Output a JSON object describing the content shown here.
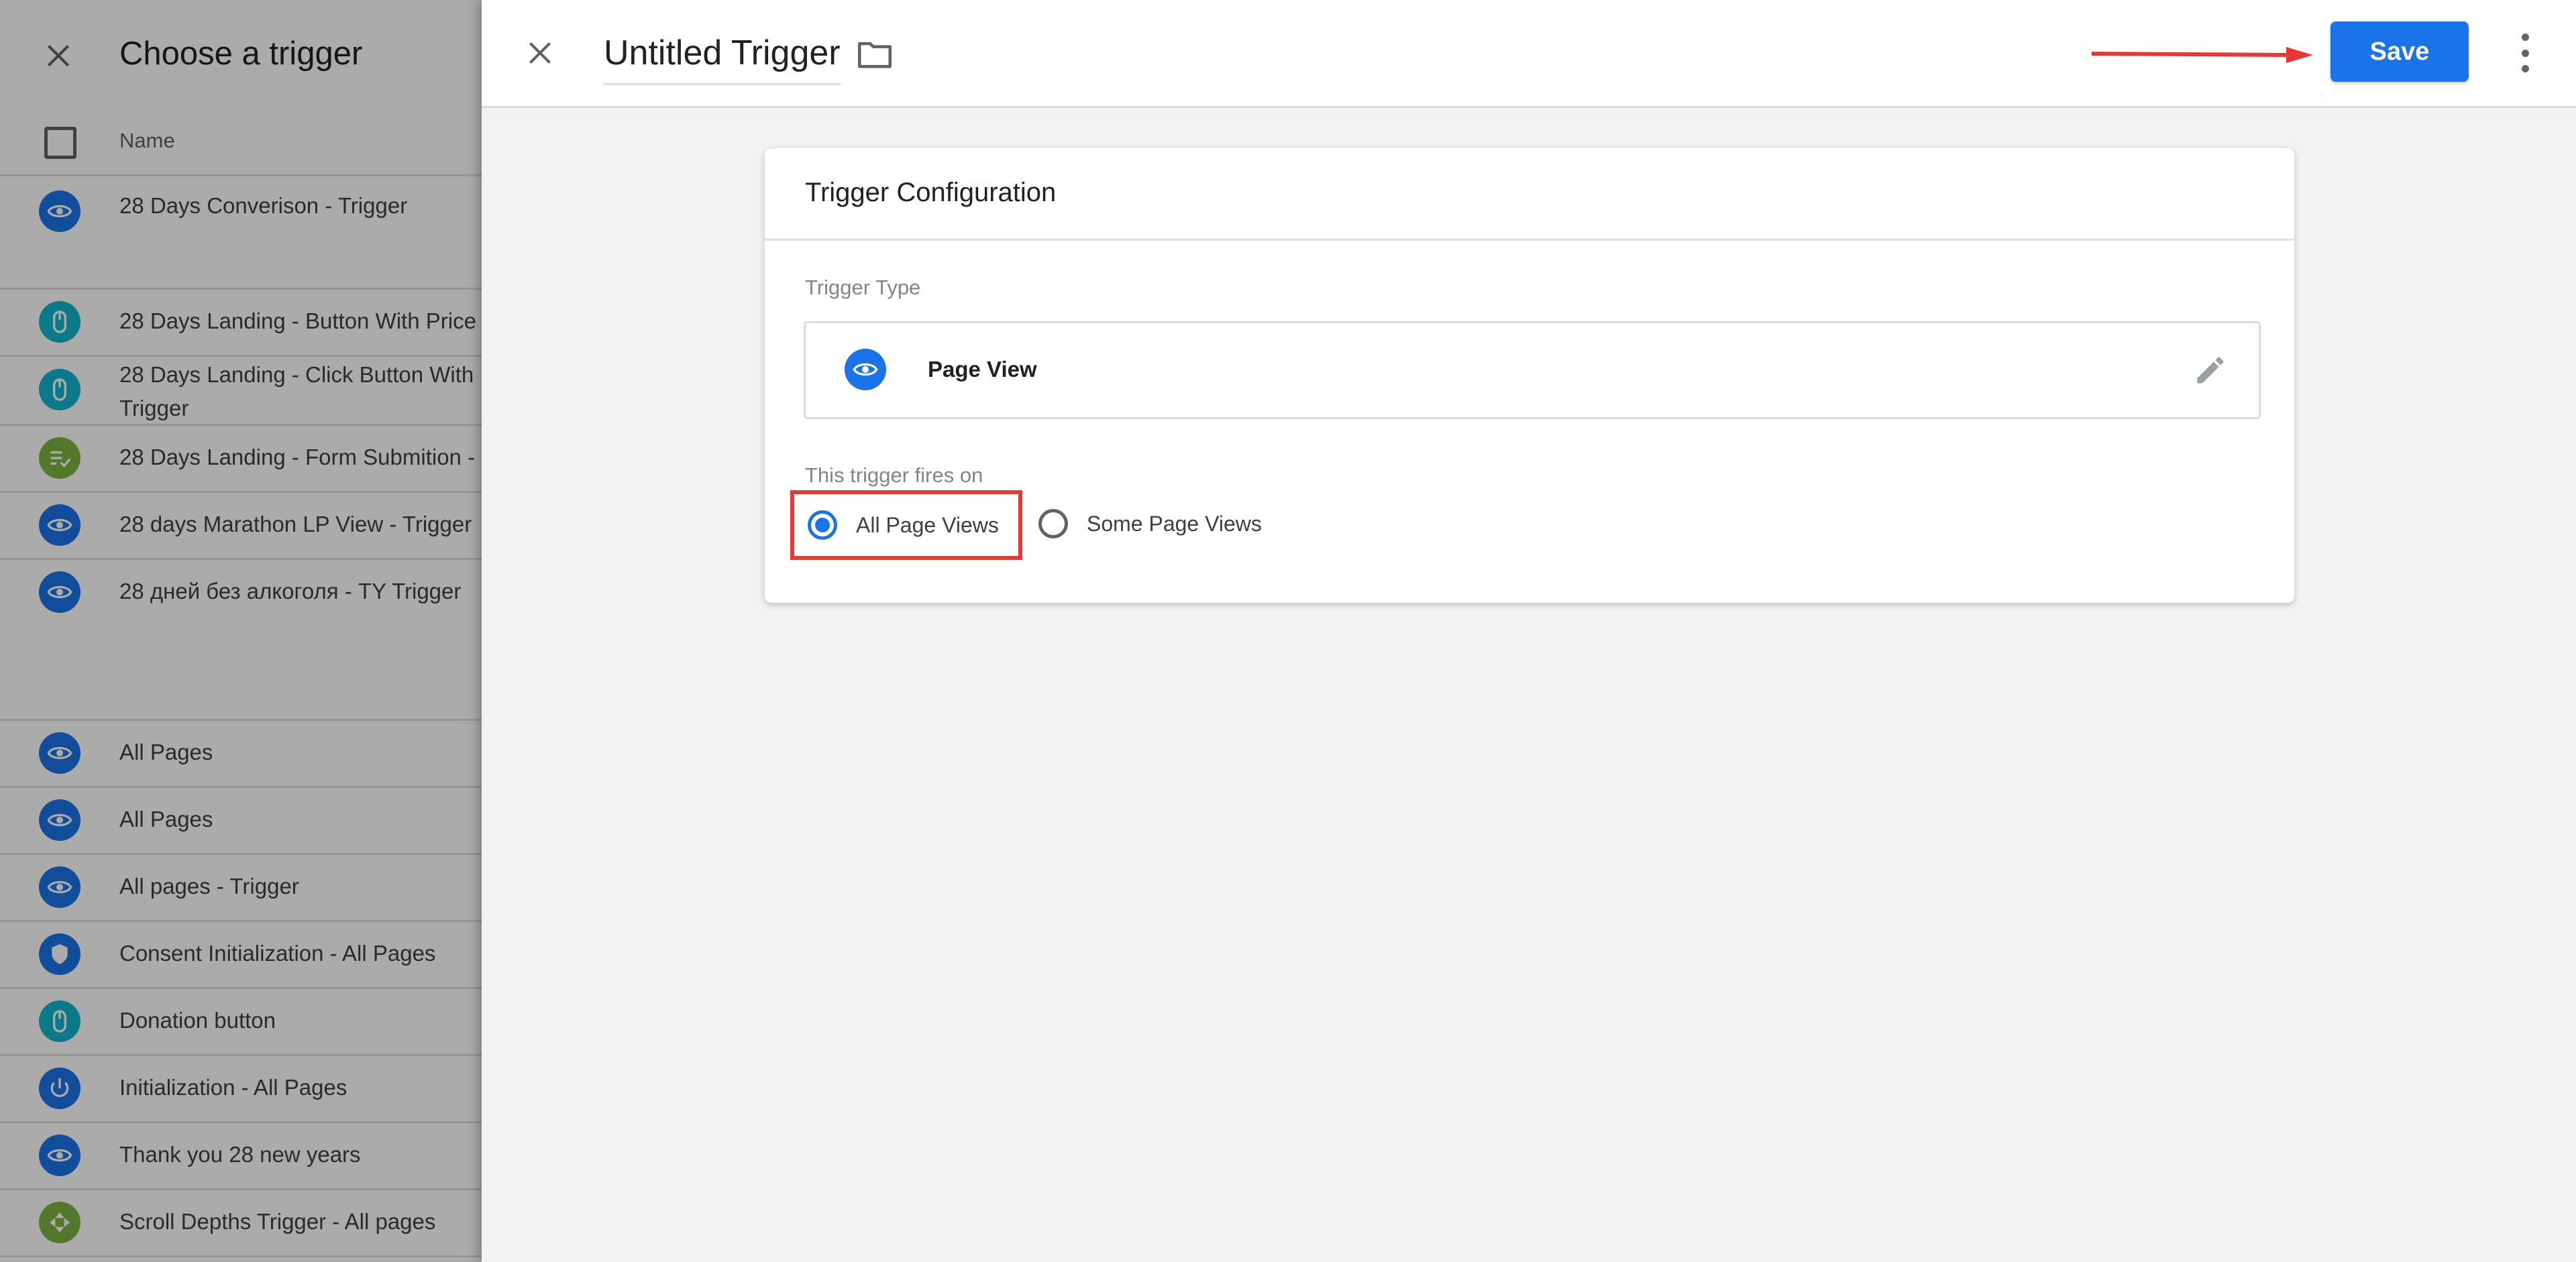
{
  "left_panel": {
    "title": "Choose a trigger",
    "column_header": "Name",
    "items": [
      {
        "label": "28 Days Converison - Trigger",
        "icon": "eye-icon"
      },
      {
        "label": "28 Days Landing - Button With Price",
        "icon": "mouse-icon"
      },
      {
        "label": "28 Days Landing - Click Button With\nTrigger",
        "icon": "mouse-icon"
      },
      {
        "label": "28 Days Landing - Form Submition -",
        "icon": "form-submit-icon"
      },
      {
        "label": "28 days Marathon LP View - Trigger",
        "icon": "eye-icon"
      },
      {
        "label": "28 дней без алкоголя - TY Trigger",
        "icon": "eye-icon"
      },
      {
        "label": "All Pages",
        "icon": "eye-icon"
      },
      {
        "label": "All Pages",
        "icon": "eye-icon"
      },
      {
        "label": "All pages - Trigger",
        "icon": "eye-icon"
      },
      {
        "label": "Consent Initialization - All Pages",
        "icon": "shield-icon"
      },
      {
        "label": "Donation button",
        "icon": "mouse-icon"
      },
      {
        "label": "Initialization - All Pages",
        "icon": "power-icon"
      },
      {
        "label": "Thank you 28 new years",
        "icon": "eye-icon"
      },
      {
        "label": "Scroll Depths Trigger - All pages",
        "icon": "scroll-icon"
      }
    ]
  },
  "editor": {
    "trigger_name": "Untitled Trigger",
    "save_label": "Save",
    "card": {
      "title": "Trigger Configuration",
      "type_label": "Trigger Type",
      "type_name": "Page View",
      "fires_label": "This trigger fires on",
      "option_all": "All Page Views",
      "option_some": "Some Page Views",
      "selected_option": "All Page Views"
    }
  },
  "colors": {
    "accent": "#1a73e8",
    "highlight": "#e53935",
    "annotation_arrow": "#e53935"
  }
}
